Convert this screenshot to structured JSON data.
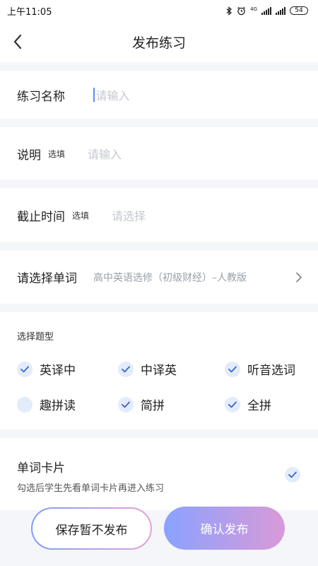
{
  "status_bar": {
    "time": "上午11:05",
    "network": "4G",
    "battery": "54"
  },
  "header": {
    "title": "发布练习"
  },
  "form": {
    "name": {
      "label": "练习名称",
      "placeholder": "请输入"
    },
    "description": {
      "label": "说明",
      "optional": "选填",
      "placeholder": "请输入"
    },
    "deadline": {
      "label": "截止时间",
      "optional": "选填",
      "placeholder": "请选择"
    },
    "words": {
      "label": "请选择单词",
      "value": "高中英语选修（初级财经）–人教版"
    }
  },
  "question_types": {
    "title": "选择题型",
    "options": [
      {
        "label": "英译中",
        "checked": true
      },
      {
        "label": "中译英",
        "checked": true
      },
      {
        "label": "听音选词",
        "checked": true
      },
      {
        "label": "趣拼读",
        "checked": false
      },
      {
        "label": "简拼",
        "checked": true
      },
      {
        "label": "全拼",
        "checked": true
      }
    ]
  },
  "word_card": {
    "title": "单词卡片",
    "description": "勾选后学生先看单词卡片再进入练习",
    "checked": true
  },
  "actions": {
    "save_label": "保存暂不发布",
    "confirm_label": "确认发布"
  },
  "colors": {
    "accent_blue": "#5b8cff",
    "gradient_start": "#8aa2ff",
    "gradient_end": "#d99ad8",
    "check_bg": "#e3ecfa",
    "placeholder": "#c4c8d0"
  }
}
